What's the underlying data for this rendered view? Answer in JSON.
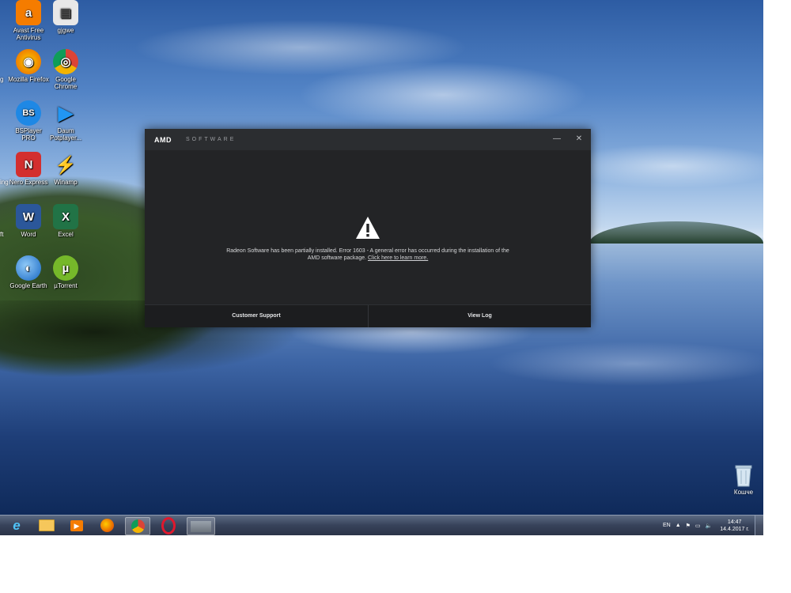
{
  "desktop": {
    "icons": [
      {
        "label": "Avast Free Antivirus",
        "color": "#f57c00",
        "glyph": "a"
      },
      {
        "label": "gjgwe",
        "color": "#e8e8e8",
        "glyph": "▤"
      },
      {
        "label": "Mozilla Firefox",
        "color": "#e66000",
        "glyph": "◉"
      },
      {
        "label": "Google Chrome",
        "color": "#db4437",
        "glyph": "◎"
      },
      {
        "label": "BSPlayer PRO",
        "color": "#1e88e5",
        "glyph": "BS"
      },
      {
        "label": "Daum Potplayer...",
        "color": "#2196f3",
        "glyph": "▶"
      },
      {
        "label": "Nero Express",
        "color": "#d32f2f",
        "glyph": "N"
      },
      {
        "label": "Winamp",
        "color": "#f9a825",
        "glyph": "⚡"
      },
      {
        "label": "Word",
        "color": "#2b579a",
        "glyph": "W"
      },
      {
        "label": "Excel",
        "color": "#217346",
        "glyph": "X"
      },
      {
        "label": "Google Earth",
        "color": "#1565c0",
        "glyph": "◐"
      },
      {
        "label": "µTorrent",
        "color": "#76b82a",
        "glyph": "µ"
      }
    ],
    "partial_labels": [
      "g",
      "ing",
      "ft"
    ],
    "recycle_bin": "Кошче"
  },
  "dialog": {
    "brand": "AMD",
    "brand_sub": "SOFTWARE",
    "minimize": "—",
    "close": "✕",
    "message": "Radeon Software has been partially installed. Error 1603 - A general error has occurred during the installation of the AMD software package.",
    "link": "Click here to learn more.",
    "support_button": "Customer Support",
    "log_button": "View Log"
  },
  "taskbar": {
    "language": "EN",
    "time": "14:47",
    "date": "14.4.2017 г."
  }
}
